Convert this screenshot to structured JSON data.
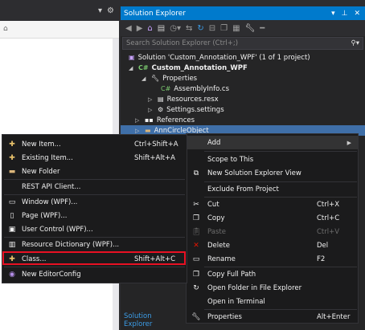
{
  "solution_explorer": {
    "title": "Solution Explorer",
    "search_placeholder": "Search Solution Explorer (Ctrl+;)",
    "bottom_tab": "Solution Explorer",
    "tree": [
      {
        "label": "Solution 'Custom_Annotation_WPF' (1 of 1 project)",
        "icon": "solution-icon"
      },
      {
        "label": "Custom_Annotation_WPF",
        "icon": "csharp-project-icon"
      },
      {
        "label": "Properties",
        "icon": "wrench-icon"
      },
      {
        "label": "AssemblyInfo.cs",
        "icon": "csharp-file-icon"
      },
      {
        "label": "Resources.resx",
        "icon": "resx-icon"
      },
      {
        "label": "Settings.settings",
        "icon": "settings-file-icon"
      },
      {
        "label": "References",
        "icon": "references-icon"
      },
      {
        "label": "AnnCircleObject",
        "icon": "folder-icon"
      }
    ]
  },
  "add_submenu": {
    "items": [
      {
        "label": "New Item...",
        "shortcut": "Ctrl+Shift+A",
        "icon": "new-item-icon"
      },
      {
        "label": "Existing Item...",
        "shortcut": "Shift+Alt+A",
        "icon": "existing-item-icon"
      },
      {
        "label": "New Folder",
        "shortcut": "",
        "icon": "new-folder-icon"
      },
      {
        "label": "REST API Client...",
        "shortcut": "",
        "icon": ""
      },
      {
        "label": "Window (WPF)...",
        "shortcut": "",
        "icon": "window-icon"
      },
      {
        "label": "Page (WPF)...",
        "shortcut": "",
        "icon": "page-icon"
      },
      {
        "label": "User Control (WPF)...",
        "shortcut": "",
        "icon": "user-control-icon"
      },
      {
        "label": "Resource Dictionary (WPF)...",
        "shortcut": "",
        "icon": "resource-dictionary-icon"
      },
      {
        "label": "Class...",
        "shortcut": "Shift+Alt+C",
        "icon": "class-icon"
      },
      {
        "label": "New EditorConfig",
        "shortcut": "",
        "icon": "editorconfig-icon"
      }
    ]
  },
  "context_menu": {
    "items": [
      {
        "label": "Add",
        "shortcut": "",
        "icon": ""
      },
      {
        "label": "Scope to This",
        "shortcut": "",
        "icon": ""
      },
      {
        "label": "New Solution Explorer View",
        "shortcut": "",
        "icon": "new-view-icon"
      },
      {
        "label": "Exclude From Project",
        "shortcut": "",
        "icon": ""
      },
      {
        "label": "Cut",
        "shortcut": "Ctrl+X",
        "icon": "cut-icon"
      },
      {
        "label": "Copy",
        "shortcut": "Ctrl+C",
        "icon": "copy-icon"
      },
      {
        "label": "Paste",
        "shortcut": "Ctrl+V",
        "icon": "paste-icon"
      },
      {
        "label": "Delete",
        "shortcut": "Del",
        "icon": "delete-icon"
      },
      {
        "label": "Rename",
        "shortcut": "F2",
        "icon": "rename-icon"
      },
      {
        "label": "Copy Full Path",
        "shortcut": "",
        "icon": "copy-path-icon"
      },
      {
        "label": "Open Folder in File Explorer",
        "shortcut": "",
        "icon": "open-folder-icon"
      },
      {
        "label": "Open in Terminal",
        "shortcut": "",
        "icon": ""
      },
      {
        "label": "Properties",
        "shortcut": "Alt+Enter",
        "icon": "wrench-icon"
      }
    ]
  },
  "colors": {
    "accent": "#007acc",
    "selection": "#3f6fa8",
    "highlight_box": "#e81123",
    "delete_icon": "#e51400"
  }
}
